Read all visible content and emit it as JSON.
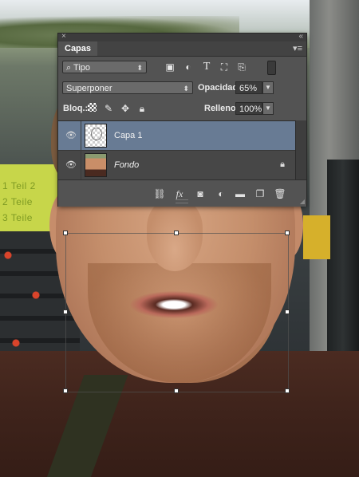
{
  "background": {
    "sign_lines": [
      "1 Teil 2",
      "2 Teile",
      "3 Teile"
    ]
  },
  "panel": {
    "tab_label": "Capas",
    "filter_kind": "Tipo",
    "blend_mode": "Superponer",
    "opacity_label": "Opacidad:",
    "opacity_value": "65%",
    "lock_label": "Bloq.:",
    "fill_label": "Relleno:",
    "fill_value": "100%",
    "layers": [
      {
        "name": "Capa 1",
        "selected": true,
        "visible": true,
        "locked": false
      },
      {
        "name": "Fondo",
        "selected": false,
        "visible": true,
        "locked": true
      }
    ],
    "filter_icons": [
      "image-filter-icon",
      "adjustment-filter-icon",
      "type-filter-icon",
      "shape-filter-icon",
      "smart-object-filter-icon"
    ],
    "footer_icons": [
      "link-icon",
      "fx-icon",
      "mask-icon",
      "adjustment-icon",
      "folder-icon",
      "new-layer-icon",
      "trash-icon"
    ],
    "fx_label": "fx",
    "colors": {
      "panel_bg": "#535353",
      "selected_row": "#687b94"
    }
  }
}
